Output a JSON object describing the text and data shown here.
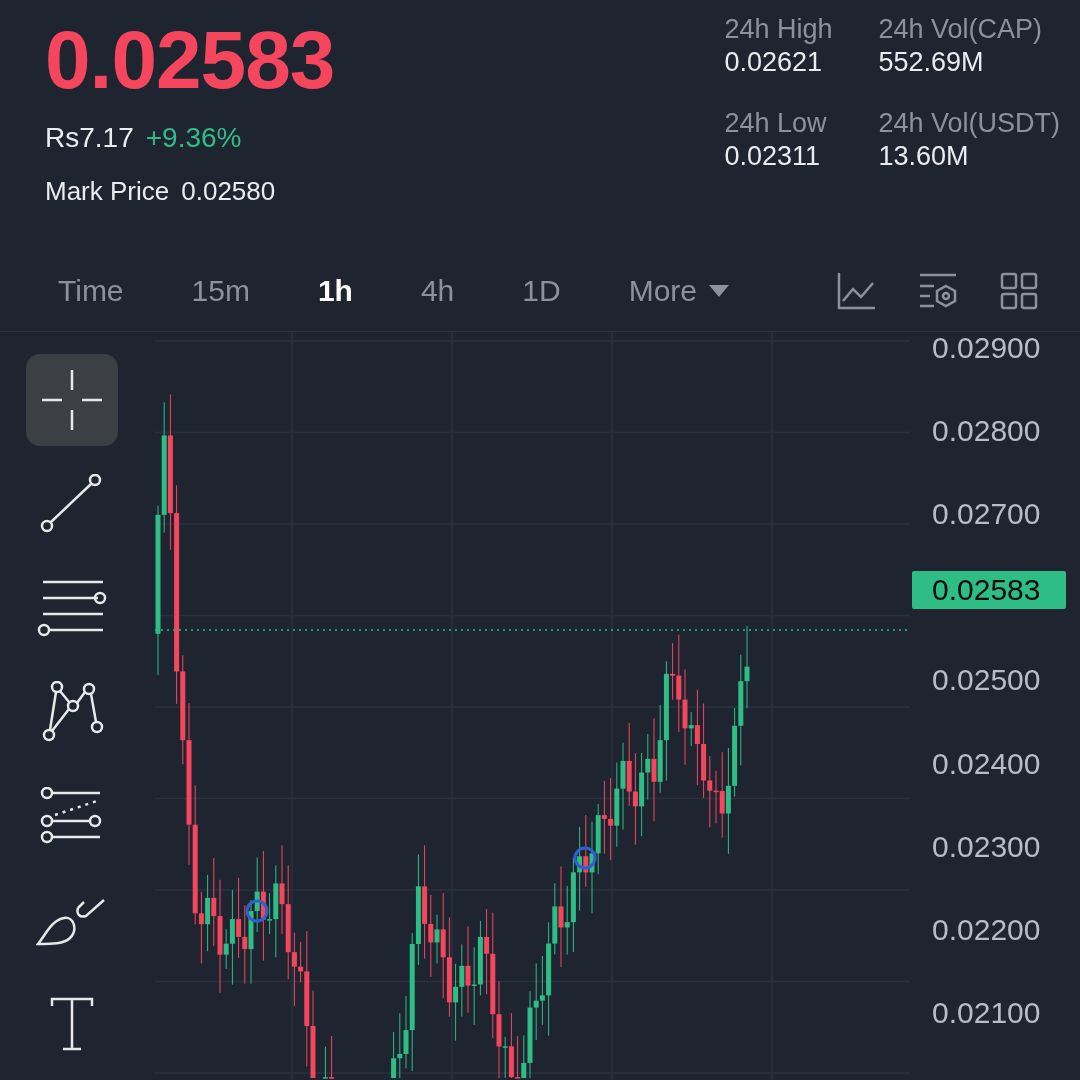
{
  "ticker": {
    "last_price": "0.02583",
    "fiat_price": "Rs7.17",
    "change": "+9.36%",
    "mark_price_label": "Mark Price",
    "mark_price": "0.02580"
  },
  "stats": [
    {
      "label": "24h High",
      "value": "0.02621"
    },
    {
      "label": "24h Vol(CAP)",
      "value": "552.69M"
    },
    {
      "label": "24h Low",
      "value": "0.02311"
    },
    {
      "label": "24h Vol(USDT)",
      "value": "13.60M"
    }
  ],
  "intervals": [
    {
      "label": "Time",
      "selected": false
    },
    {
      "label": "15m",
      "selected": false
    },
    {
      "label": "1h",
      "selected": true
    },
    {
      "label": "4h",
      "selected": false
    },
    {
      "label": "1D",
      "selected": false
    },
    {
      "label": "More",
      "selected": false
    }
  ],
  "tools": [
    {
      "selected": true
    },
    {
      "selected": false
    },
    {
      "selected": false
    },
    {
      "selected": false
    },
    {
      "selected": false
    },
    {
      "selected": false
    },
    {
      "selected": false
    }
  ],
  "price_axis": [
    {
      "kind": "tick",
      "label": "0.02900"
    },
    {
      "kind": "tick",
      "label": "0.02800"
    },
    {
      "kind": "tick",
      "label": "0.02700"
    },
    {
      "kind": "current",
      "label": "0.02583"
    },
    {
      "kind": "tick",
      "label": "0.02500"
    },
    {
      "kind": "tick",
      "label": "0.02400"
    },
    {
      "kind": "tick",
      "label": "0.02300"
    },
    {
      "kind": "tick",
      "label": "0.02200"
    },
    {
      "kind": "tick",
      "label": "0.02100"
    }
  ]
}
